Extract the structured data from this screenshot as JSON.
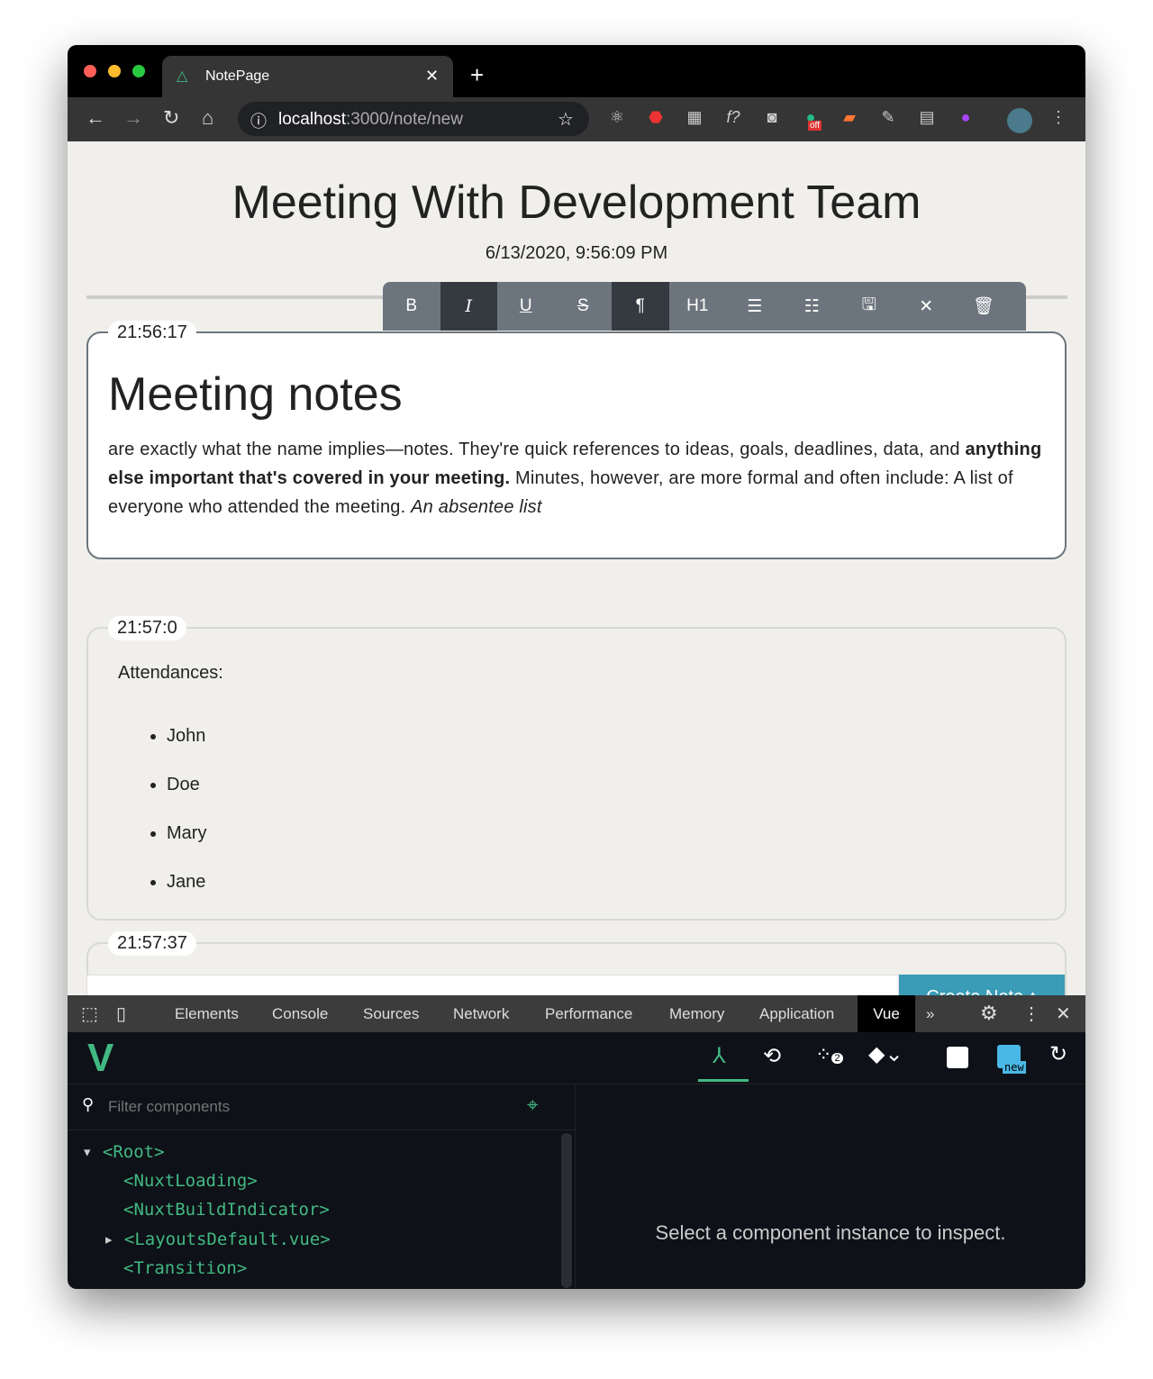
{
  "browser": {
    "tab_title": "NotePage",
    "url_host": "localhost",
    "url_path": ":3000/note/new",
    "ext_off_badge": "off"
  },
  "page": {
    "title": "Meeting With Development Team",
    "date": "6/13/2020, 9:56:09 PM",
    "toolbar": [
      "B",
      "I",
      "U",
      "S",
      "¶",
      "H1",
      "☰",
      "☷",
      "🖫",
      "✕",
      "🗑"
    ],
    "notes": [
      {
        "time": "21:56:17",
        "heading": "Meeting notes",
        "p1": "are exactly what the name implies—notes. They're quick references to ideas, goals, deadlines, data, and ",
        "p_bold": "anything else important that's covered in your meeting.",
        "p2": " Minutes, however, are more formal and often include: A list of everyone who attended the meeting. ",
        "p_italic": "An absentee list"
      },
      {
        "time": "21:57:0",
        "label": "Attendances:",
        "items": [
          "John",
          "Doe",
          "Mary",
          "Jane"
        ]
      },
      {
        "time": "21:57:37"
      }
    ],
    "input_value": "",
    "create_button": "Create Note ↑"
  },
  "devtools": {
    "tabs": [
      "Elements",
      "Console",
      "Sources",
      "Network",
      "Performance",
      "Memory",
      "Application",
      "Vue"
    ],
    "more": "»",
    "filter_placeholder": "Filter components",
    "badge_count": "2",
    "new_badge": "new",
    "tree": [
      "<Root>",
      "<NuxtLoading>",
      "<NuxtBuildIndicator>",
      "<LayoutsDefault.vue>",
      "<Transition>"
    ],
    "inspect_msg": "Select a component instance to inspect."
  }
}
